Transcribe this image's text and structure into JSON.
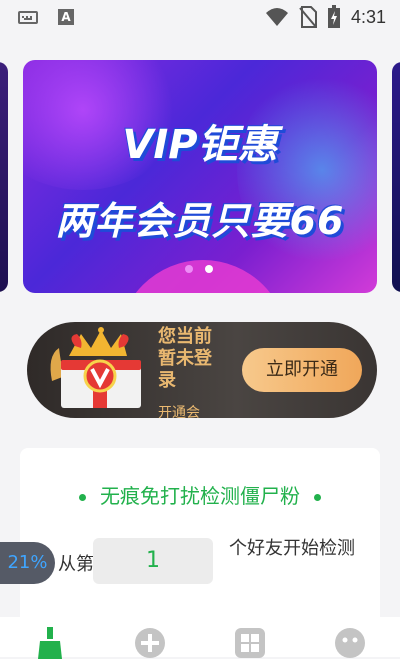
{
  "status_bar": {
    "left_icons": [
      "keyboard-icon",
      "a-icon"
    ],
    "a_icon_text": "A",
    "right_icons": [
      "wifi-icon",
      "no-sim-icon",
      "battery-charging-icon"
    ],
    "time": "4:31"
  },
  "banner": {
    "title": "VIP钜惠",
    "subtitle": "两年会员只要66",
    "slide_count": 2,
    "active_slide": 1
  },
  "vip_card": {
    "status_text": "您当前暂未登录",
    "sub_text": "开通会",
    "button_label": "立即开通",
    "icon": "vip-gift-icon"
  },
  "detect_card": {
    "title": "无痕免打扰检测僵尸粉",
    "from_label": "从第",
    "count_value": "1",
    "after_label": "个好友开始检测"
  },
  "floating_badge": {
    "text": "21%"
  },
  "bottom_nav": {
    "items": [
      "broom-icon",
      "plus-icon",
      "grid-icon",
      "face-icon"
    ],
    "active_index": 0
  },
  "colors": {
    "accent_green": "#22b14c",
    "gold": "#e9b870",
    "banner_purple": "#6a2ee0"
  }
}
